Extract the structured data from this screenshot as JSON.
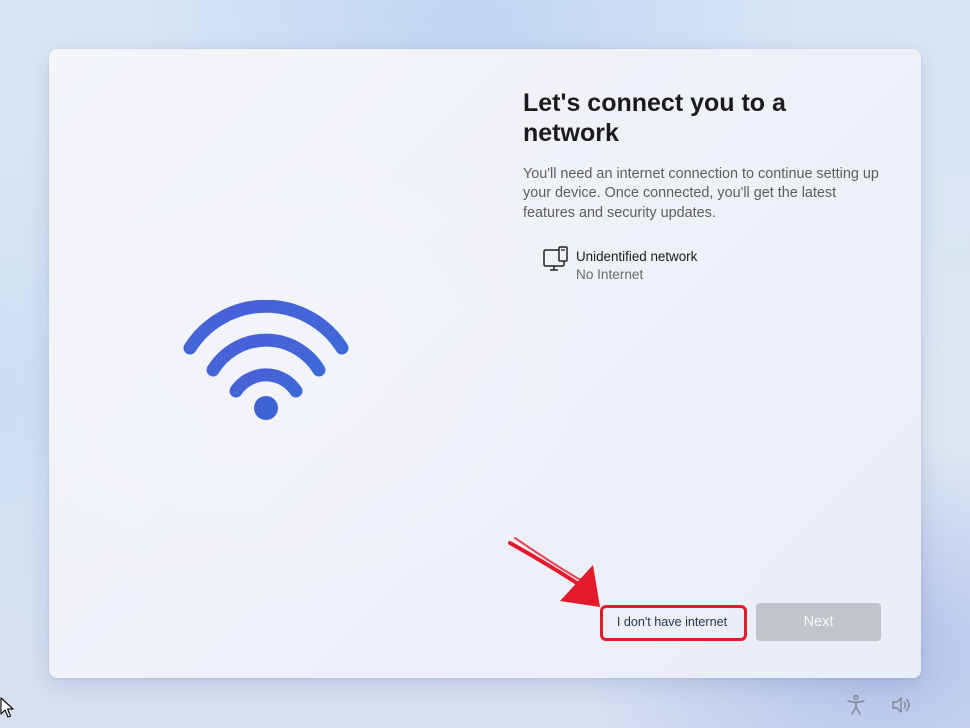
{
  "main": {
    "title": "Let's connect you to a network",
    "description": "You'll need an internet connection to continue setting up your device. Once connected, you'll get the latest features and security updates.",
    "hero_icon": "wifi-icon",
    "hero_color": "#3f5fd6"
  },
  "networks": [
    {
      "icon": "network-computer-icon",
      "name": "Unidentified network",
      "status": "No Internet"
    }
  ],
  "actions": {
    "no_internet_label": "I don't have internet",
    "next_label": "Next",
    "next_enabled": false
  },
  "annotation": {
    "highlight_color": "#e3192c"
  },
  "system_tray": {
    "icons": [
      "accessibility-icon",
      "volume-icon"
    ]
  }
}
